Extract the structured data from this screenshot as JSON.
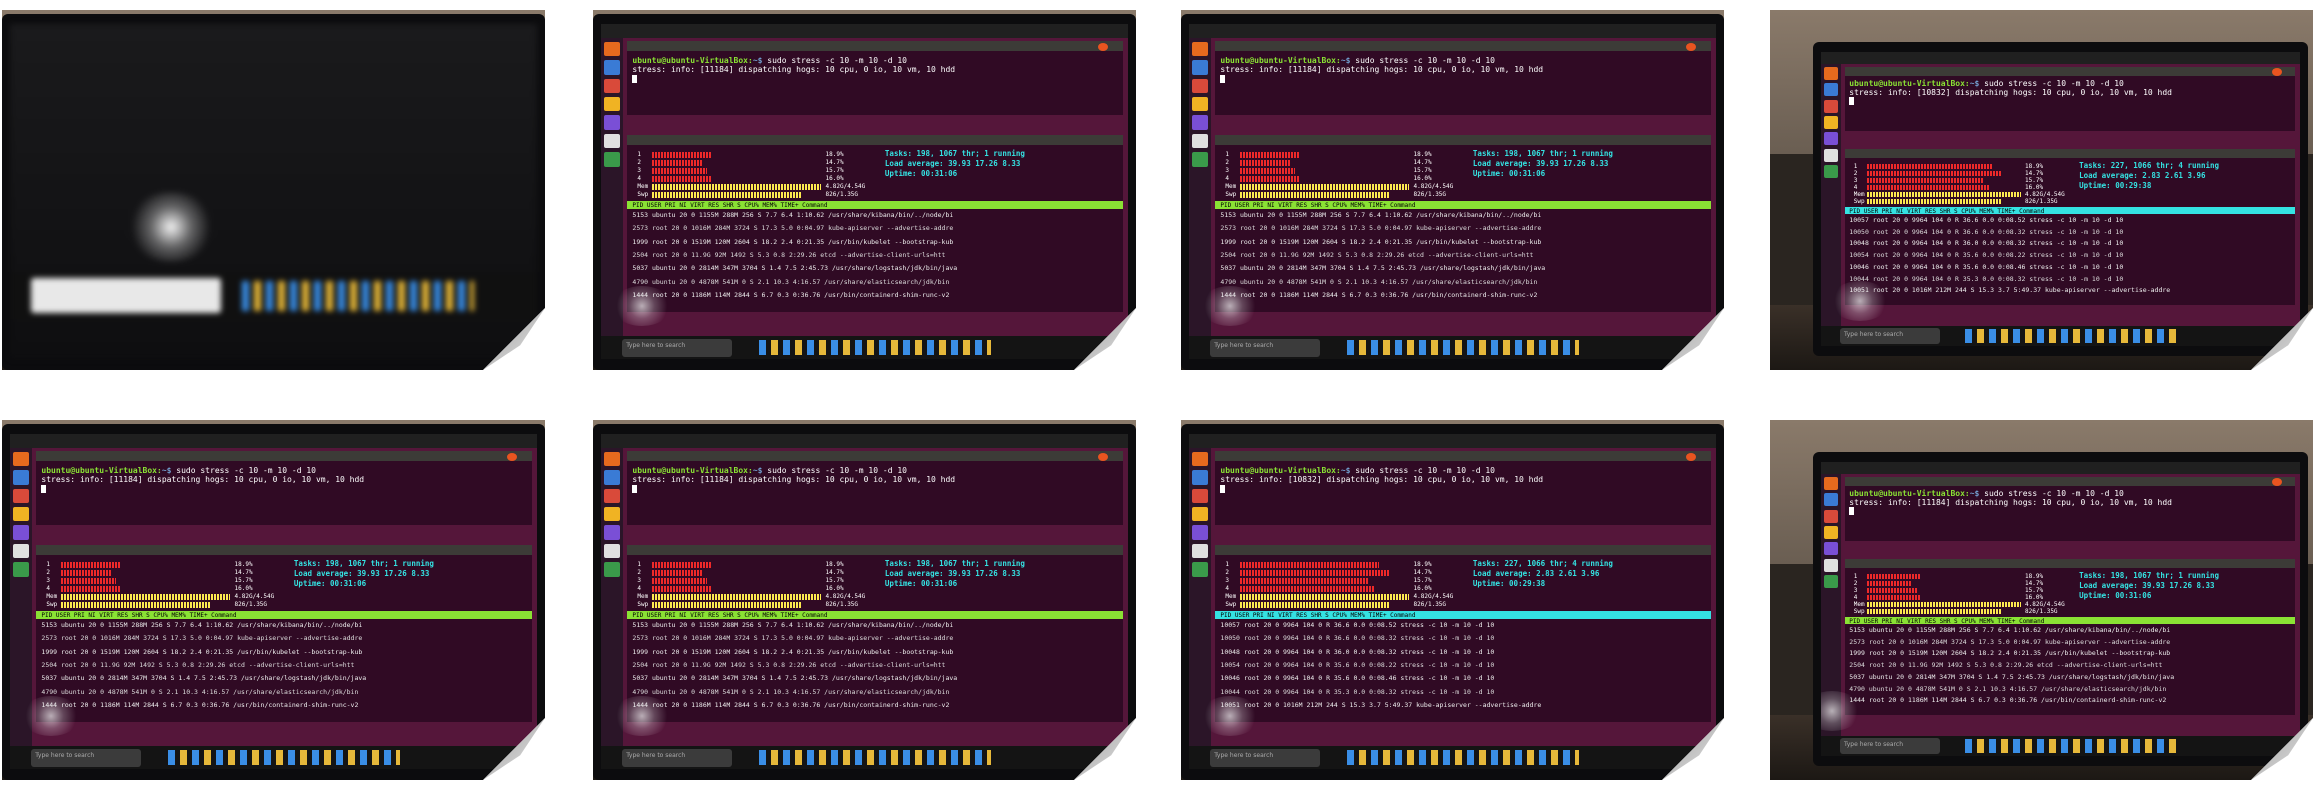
{
  "gallery": {
    "thumbnails": [
      {
        "state": "blurred-monitor"
      },
      {
        "state": "stress-running",
        "variant": "a"
      },
      {
        "state": "stress-running",
        "variant": "a"
      },
      {
        "state": "stress-running",
        "variant": "b"
      },
      {
        "state": "stress-running",
        "variant": "a"
      },
      {
        "state": "stress-running",
        "variant": "a"
      },
      {
        "state": "stress-running",
        "variant": "b"
      },
      {
        "state": "stress-running",
        "variant": "a"
      }
    ]
  },
  "terminal": {
    "prompt_user": "ubuntu@ubuntu-VirtualBox:",
    "prompt_symbol": "~$ ",
    "command": "sudo stress -c 10 -m 10 -d 10",
    "info_a": "stress: info: [11184] dispatching hogs: 10 cpu, 0 io, 10 vm, 10 hdd",
    "info_b": "stress: info: [10832] dispatching hogs: 10 cpu, 0 io, 10 vm, 10 hdd"
  },
  "htop": {
    "a": {
      "tasks": "Tasks: 198, 1067 thr; 1 running",
      "load": "Load average: 39.93 17.26 8.33",
      "uptime": "Uptime: 00:31:06"
    },
    "b": {
      "tasks": "Tasks: 227, 1066 thr; 4 running",
      "load": "Load average: 2.83 2.61 3.96",
      "uptime": "Uptime: 00:29:38"
    },
    "cpu_percents": [
      "18.9%",
      "14.7%",
      "15.7%",
      "16.0%"
    ],
    "mem_label": "Mem",
    "swp_label": "Swp",
    "mem_value": "4.82G/4.54G",
    "swp_value": "826/1.35G",
    "header": "PID USER PRI NI VIRT RES SHR S CPU% MEM% TIME+ Command",
    "processes_a": [
      "5153 ubuntu  20  0 1155M 288M  256 S  7.7  6.4  1:10.62 /usr/share/kibana/bin/../node/bi",
      "2573 root    20  0 1016M 284M 3724 S 17.3  5.0  0:04.97 kube-apiserver --advertise-addre",
      "1999 root    20  0 1519M 120M 2604 S 18.2  2.4  0:21.35 /usr/bin/kubelet --bootstrap-kub",
      "2504 root    20  0 11.9G  92M 1492 S  5.3  0.8  2:29.26 etcd --advertise-client-urls=htt",
      "5037 ubuntu  20  0 2814M 347M 3704 S  1.4  7.5  2:45.73 /usr/share/logstash/jdk/bin/java",
      "4790 ubuntu  20  0 4878M 541M    0 S  2.1 10.3  4:16.57 /usr/share/elasticsearch/jdk/bin",
      "1444 root    20  0 1186M 114M 2844 S  6.7  0.3  0:36.76 /usr/bin/containerd-shim-runc-v2"
    ],
    "processes_b": [
      "10057 root   20  0 9964  104  0 R 36.6  0.0 0:08.52 stress -c 10 -m 10 -d 10",
      "10050 root   20  0 9964  104  0 R 36.6  0.0 0:08.32 stress -c 10 -m 10 -d 10",
      "10048 root   20  0 9964  104  0 R 36.0  0.0 0:08.32 stress -c 10 -m 10 -d 10",
      "10054 root   20  0 9964  104  0 R 35.6  0.0 0:08.22 stress -c 10 -m 10 -d 10",
      "10046 root   20  0 9964  104  0 R 35.6  0.0 0:08.46 stress -c 10 -m 10 -d 10",
      "10044 root   20  0 9964  104  0 R 35.3  0.0 0:08.32 stress -c 10 -m 10 -d 10",
      "10051 root   20  0 1016M 212M 244 S 15.3  3.7 5:49.37 kube-apiserver --advertise-addre"
    ]
  },
  "taskbar": {
    "search_placeholder": "Type here to search"
  },
  "colors": {
    "ubuntu_purple": "#55163a",
    "terminal_bg": "#300a24",
    "htop_green": "#8ae234",
    "htop_cyan": "#34e2e2",
    "cpu_bar_red": "#ef2929"
  }
}
